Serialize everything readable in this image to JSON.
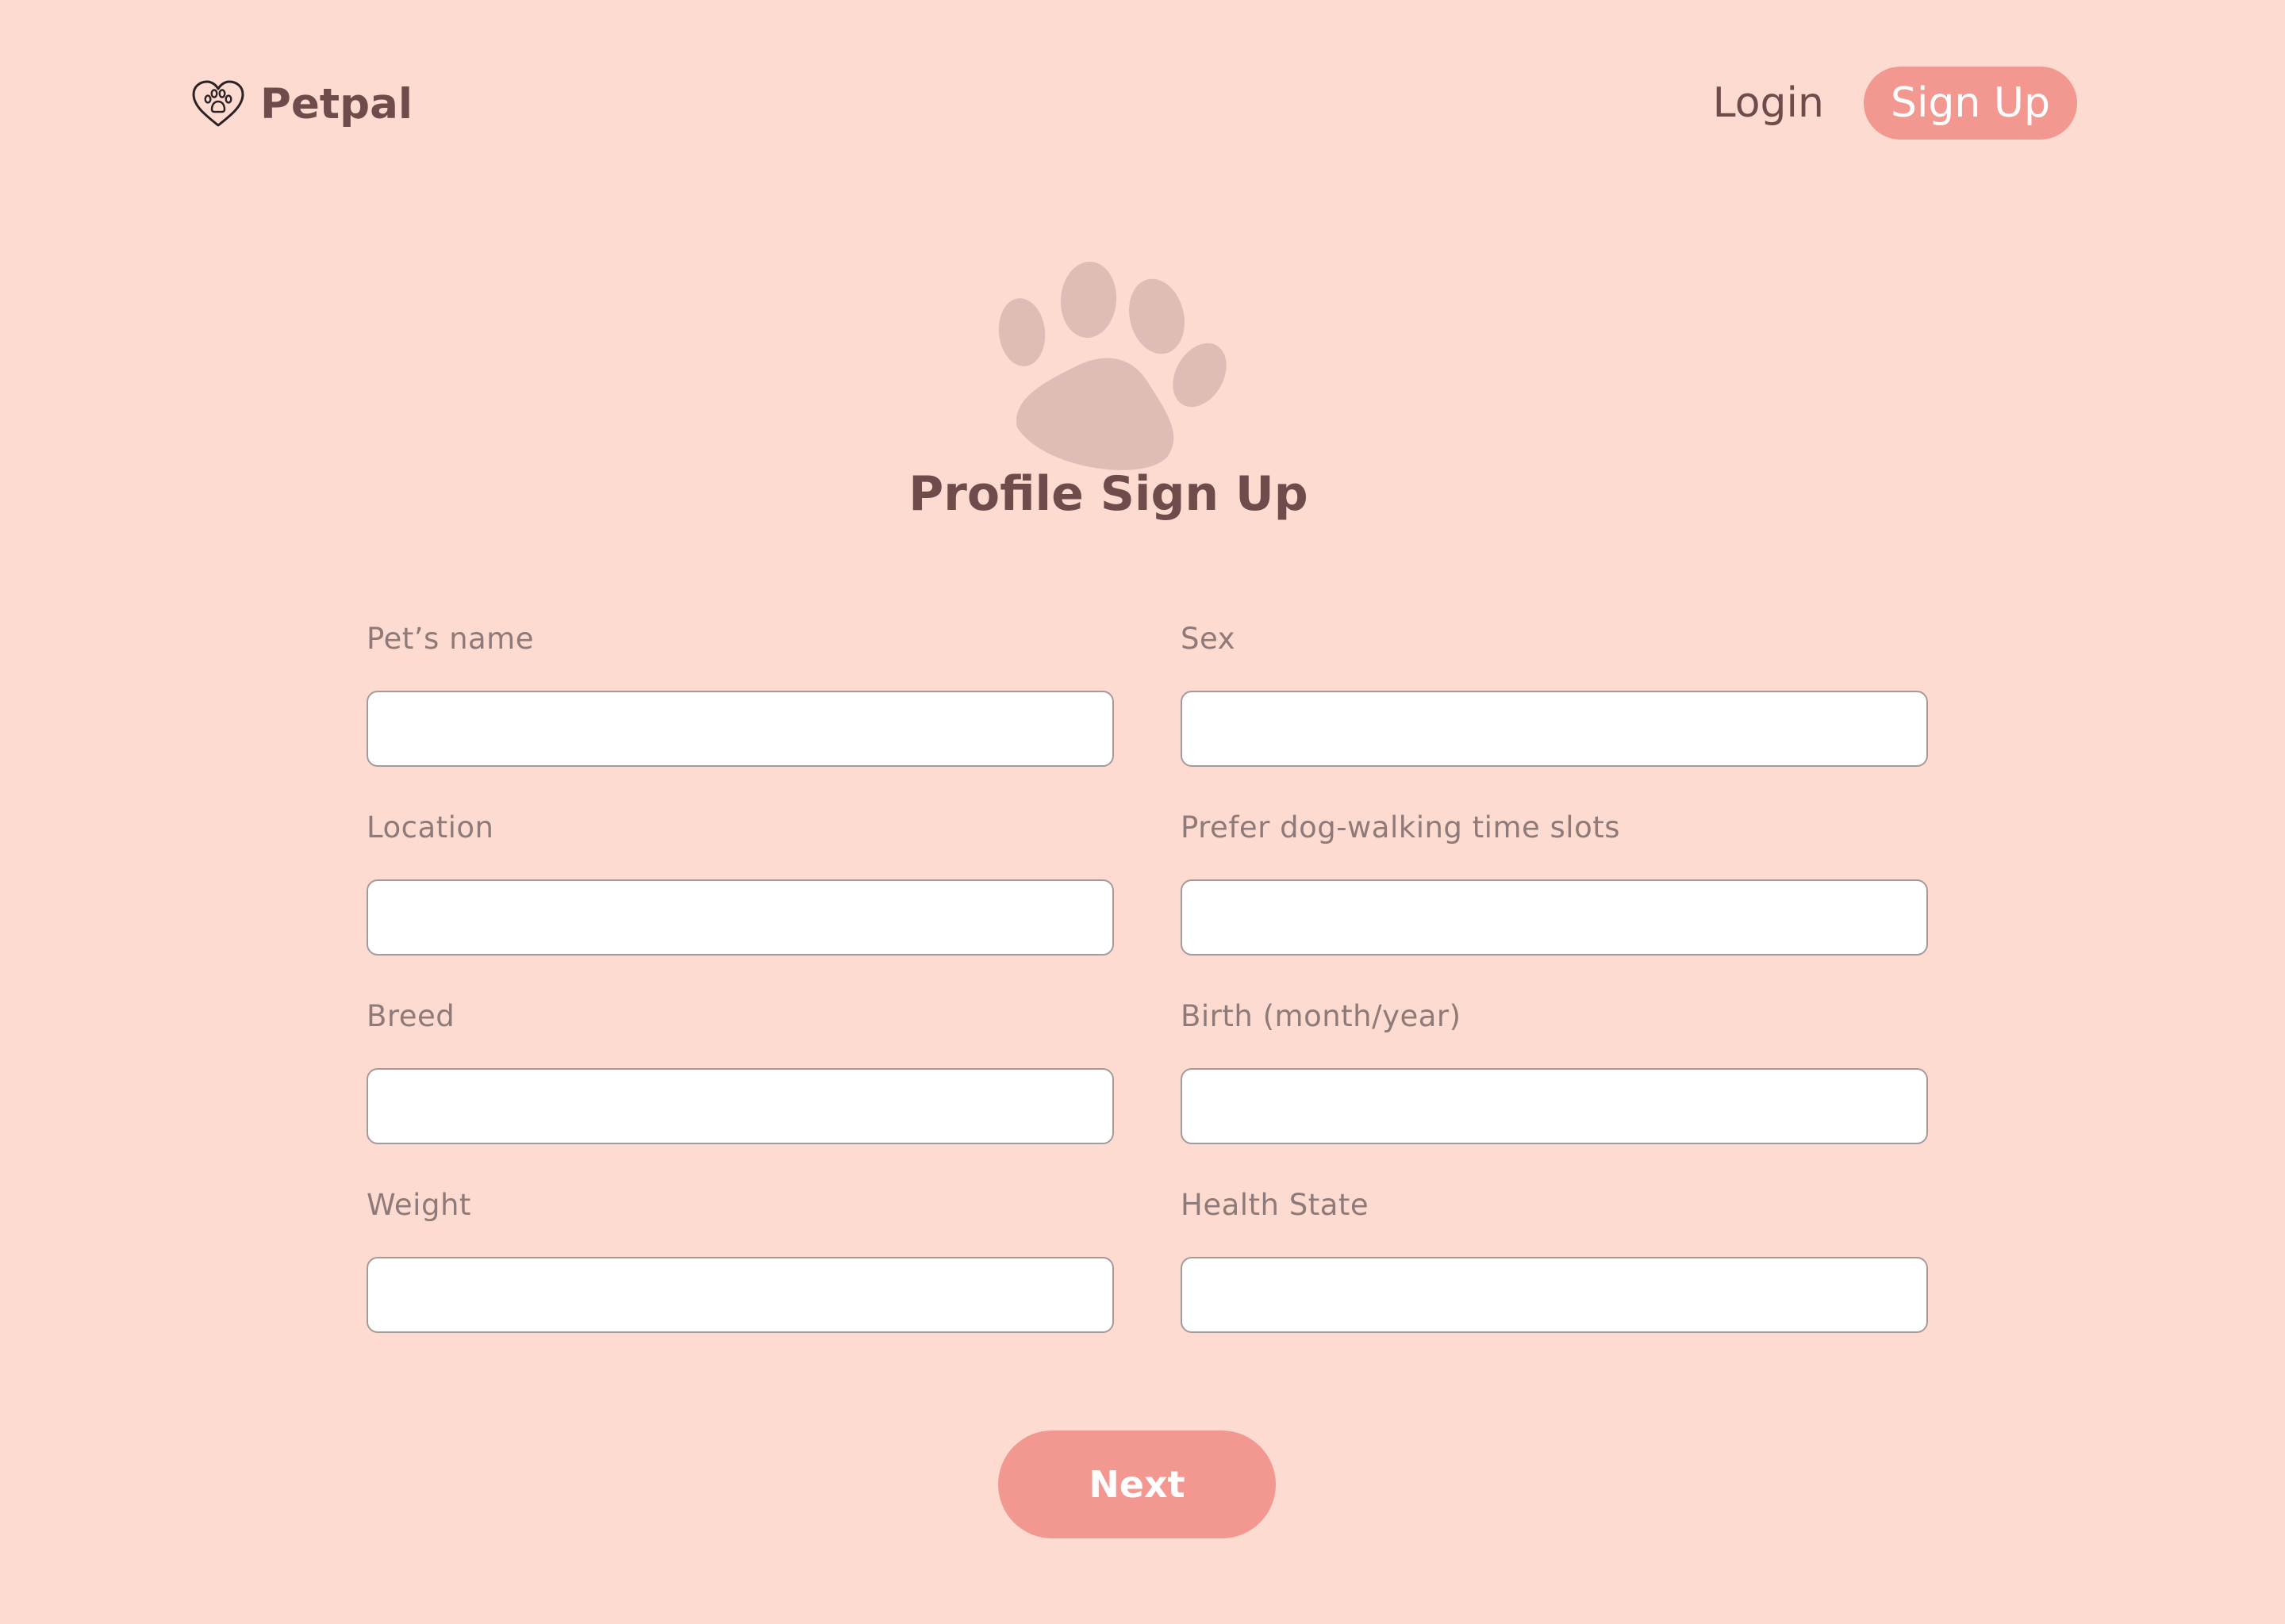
{
  "header": {
    "brand_name": "Petpal",
    "nav": {
      "login_label": "Login",
      "signup_label": "Sign Up"
    }
  },
  "hero": {
    "title": "Profile Sign Up"
  },
  "form": {
    "fields": [
      {
        "label": "Pet’s name",
        "value": "",
        "placeholder": ""
      },
      {
        "label": "Sex",
        "value": "",
        "placeholder": ""
      },
      {
        "label": "Location",
        "value": "",
        "placeholder": ""
      },
      {
        "label": "Prefer dog-walking time slots",
        "value": "",
        "placeholder": ""
      },
      {
        "label": "Breed",
        "value": "",
        "placeholder": ""
      },
      {
        "label": "Birth (month/year)",
        "value": "",
        "placeholder": ""
      },
      {
        "label": "Weight",
        "value": "",
        "placeholder": ""
      },
      {
        "label": "Health State",
        "value": "",
        "placeholder": ""
      }
    ],
    "next_label": "Next"
  },
  "colors": {
    "background": "#FDDBD1",
    "accent": "#F39891",
    "text_dark": "#6F4B4B",
    "label_gray": "#8E7A78",
    "paw_watermark": "#DFBDB6"
  },
  "icons": {
    "brand": "heart-paw-icon",
    "hero": "paw-print-icon"
  }
}
